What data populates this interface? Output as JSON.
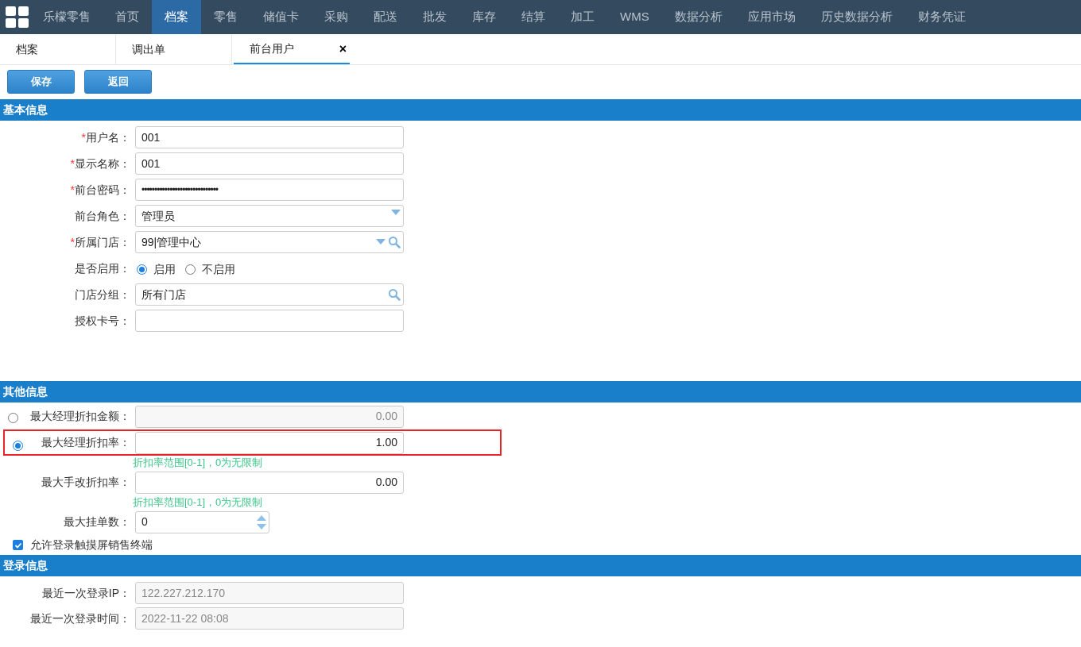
{
  "nav": {
    "brand": "乐檬零售",
    "items": [
      {
        "label": "首页",
        "selected": false
      },
      {
        "label": "档案",
        "selected": true
      },
      {
        "label": "零售",
        "selected": false
      },
      {
        "label": "储值卡",
        "selected": false
      },
      {
        "label": "采购",
        "selected": false
      },
      {
        "label": "配送",
        "selected": false
      },
      {
        "label": "批发",
        "selected": false
      },
      {
        "label": "库存",
        "selected": false
      },
      {
        "label": "结算",
        "selected": false
      },
      {
        "label": "加工",
        "selected": false
      },
      {
        "label": "WMS",
        "selected": false
      },
      {
        "label": "数据分析",
        "selected": false
      },
      {
        "label": "应用市场",
        "selected": false
      },
      {
        "label": "历史数据分析",
        "selected": false
      },
      {
        "label": "财务凭证",
        "selected": false
      }
    ]
  },
  "tabs": [
    {
      "label": "档案",
      "selected": false,
      "closable": false
    },
    {
      "label": "调出单",
      "selected": false,
      "closable": false
    },
    {
      "label": "前台用户",
      "selected": true,
      "closable": true,
      "close_glyph": "×"
    }
  ],
  "buttons": [
    "保存",
    "返回"
  ],
  "basic_info": {
    "title": "基本信息",
    "fields": [
      {
        "kind": "text",
        "required_mark": "*",
        "label": "用户名：",
        "value": "001"
      },
      {
        "kind": "text",
        "required_mark": "*",
        "label": "显示名称：",
        "value": "001"
      },
      {
        "kind": "password",
        "required_mark": "*",
        "label": "前台密码：",
        "value": "••••••••••••••••••••••••••••••"
      },
      {
        "kind": "dropdown",
        "label": "前台角色：",
        "value": "管理员"
      },
      {
        "kind": "dropdown_lookup",
        "required_mark": "*",
        "label": "所属门店：",
        "value": "99|管理中心"
      },
      {
        "kind": "radio",
        "label": "是否启用：",
        "options": [
          {
            "label": "启用",
            "selected": true
          },
          {
            "label": "不启用",
            "selected": false
          }
        ]
      },
      {
        "kind": "lookup",
        "label": "门店分组：",
        "value": "所有门店"
      },
      {
        "kind": "text",
        "label": "授权卡号："
      }
    ]
  },
  "other_info": {
    "title": "其他信息",
    "discount_options": [
      {
        "label": "最大经理折扣金额：",
        "value": "0.00",
        "selected": false,
        "disabled": true,
        "highlighted": false
      },
      {
        "label": "最大经理折扣率：",
        "value": "1.00",
        "selected": true,
        "disabled": false,
        "highlighted": true,
        "hint": "折扣率范围[0-1]，0为无限制"
      }
    ],
    "fields": [
      {
        "kind": "number",
        "label": "最大手改折扣率：",
        "value": "0.00",
        "hint": "折扣率范围[0-1]，0为无限制"
      },
      {
        "kind": "spinner",
        "label": "最大挂单数：",
        "value": "0"
      }
    ],
    "checkbox": {
      "label": "允许登录触摸屏销售终端",
      "checked": true
    }
  },
  "login_info": {
    "title": "登录信息",
    "fields": [
      {
        "label": "最近一次登录IP：",
        "value": "122.227.212.170",
        "disabled": true
      },
      {
        "label": "最近一次登录时间：",
        "value": "2022-11-22 08:08",
        "disabled": true
      }
    ]
  }
}
